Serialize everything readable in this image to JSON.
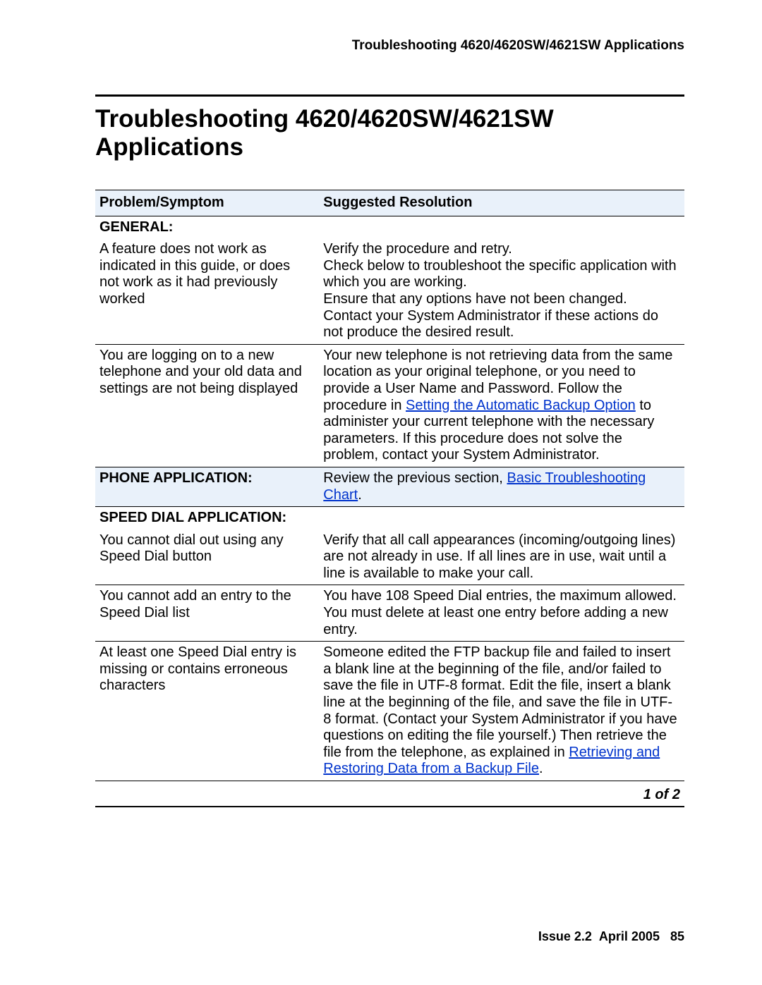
{
  "header": {
    "running": "Troubleshooting 4620/4620SW/4621SW Applications"
  },
  "title": "Troubleshooting 4620/4620SW/4621SW Applications",
  "table": {
    "head_left": "Problem/Symptom",
    "head_right": "Suggested Resolution",
    "sections": {
      "general_label": "GENERAL:",
      "phone_label": "PHONE APPLICATION:",
      "speed_label": "SPEED DIAL APPLICATION:"
    },
    "rows": {
      "g1_problem": "A feature does not work as indicated in this guide, or does not work as it had previously worked",
      "g1_res": "Verify the procedure and retry.\nCheck below to troubleshoot the specific application with which you are working.\nEnsure that any options have not been changed.\nContact your System Administrator if these actions do not produce the desired result.",
      "g2_problem": "You are logging on to a new telephone and your old data and settings are not being displayed",
      "g2_res_a": "Your new telephone is not retrieving data from the same location as your original telephone, or you need to provide a User Name and Password. Follow the procedure in ",
      "g2_link": "Setting the Automatic Backup Option",
      "g2_res_b": " to administer your current telephone with the necessary parameters. If this procedure does not solve the problem, contact your System Administrator.",
      "phone_res_a": "Review the previous section, ",
      "phone_link": "Basic Troubleshooting Chart",
      "phone_res_b": ".",
      "s1_problem": "You cannot dial out using any Speed Dial button",
      "s1_res": "Verify that all call appearances (incoming/outgoing lines) are not already in use. If all lines are in use, wait until a line is available to make your call.",
      "s2_problem": "You cannot add an entry to the Speed Dial list",
      "s2_res": "You have 108 Speed Dial entries, the maximum allowed. You must delete at least one entry before adding a new entry.",
      "s3_problem": "At least one Speed Dial entry is missing or contains erroneous characters",
      "s3_res_a": "Someone edited the FTP backup file and failed to insert a blank line at the beginning of the file, and/or failed to save the file in UTF-8 format. Edit the file, insert a blank line at the beginning of the file, and save the file in UTF-8 format. (Contact your System Administrator if you have questions on editing the file yourself.) Then retrieve the file from the telephone, as explained in ",
      "s3_link": "Retrieving and Restoring Data from a Backup File",
      "s3_res_b": "."
    },
    "pager": "1 of 2"
  },
  "footer": {
    "issue": "Issue 2.2",
    "date": "April 2005",
    "page": "85"
  }
}
